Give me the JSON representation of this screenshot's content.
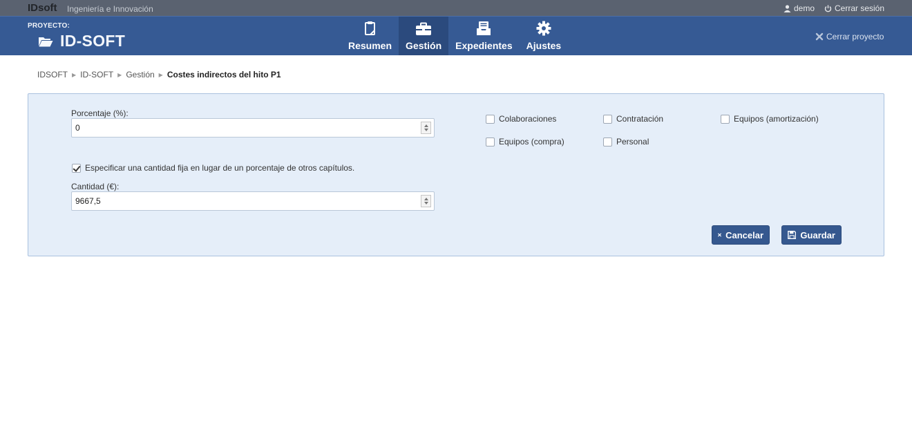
{
  "topbar": {
    "brand": "IDsoft",
    "tagline": "Ingeniería e Innovación",
    "user": "demo",
    "logout": "Cerrar sesión"
  },
  "project": {
    "label": "PROYECTO:",
    "name": "ID-SOFT",
    "close": "Cerrar proyecto"
  },
  "nav": {
    "items": [
      {
        "label": "Resumen",
        "icon": "clipboard-icon"
      },
      {
        "label": "Gestión",
        "icon": "briefcase-icon",
        "active": true
      },
      {
        "label": "Expedientes",
        "icon": "tray-icon"
      },
      {
        "label": "Ajustes",
        "icon": "gear-icon"
      }
    ]
  },
  "breadcrumb": [
    "IDSOFT",
    "ID-SOFT",
    "Gestión",
    "Costes indirectos del hito P1"
  ],
  "form": {
    "percentage_label": "Porcentaje (%):",
    "percentage_value": "0",
    "fixed_checkbox_label": "Especificar una cantidad fija en lugar de un porcentaje de otros capítulos.",
    "fixed_checked": true,
    "amount_label": "Cantidad (€):",
    "amount_value": "9667,5",
    "chapters": [
      {
        "label": "Colaboraciones",
        "checked": false
      },
      {
        "label": "Contratación",
        "checked": false
      },
      {
        "label": "Equipos (amortización)",
        "checked": false
      },
      {
        "label": "Equipos (compra)",
        "checked": false
      },
      {
        "label": "Personal",
        "checked": false
      }
    ],
    "cancel_label": "Cancelar",
    "save_label": "Guardar"
  },
  "colors": {
    "topbar": "#5a6270",
    "header": "#365a94",
    "nav_active": "#2b4a7d",
    "panel_bg": "#e5eef9",
    "button": "#35588f"
  }
}
